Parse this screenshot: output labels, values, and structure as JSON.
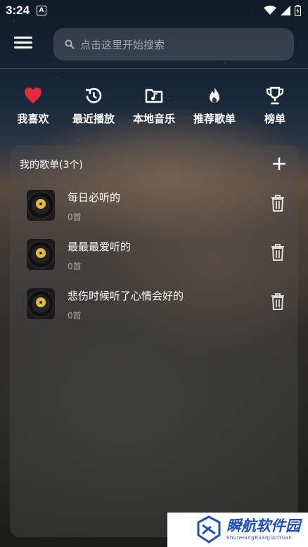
{
  "status": {
    "time": "3:24",
    "notif_letter": "A"
  },
  "search": {
    "placeholder": "点击这里开始搜索"
  },
  "quick_actions": [
    {
      "label": "我喜欢",
      "icon": "heart-icon"
    },
    {
      "label": "最近播放",
      "icon": "history-icon"
    },
    {
      "label": "本地音乐",
      "icon": "music-folder-icon"
    },
    {
      "label": "推荐歌单",
      "icon": "flame-icon"
    },
    {
      "label": "榜单",
      "icon": "trophy-icon"
    }
  ],
  "playlists": {
    "header": "我的歌单(3个)",
    "items": [
      {
        "title": "每日必听的",
        "count": "0首"
      },
      {
        "title": "最最最爱听的",
        "count": "0首"
      },
      {
        "title": "悲伤时候听了心情会好的",
        "count": "0首"
      }
    ]
  },
  "watermark": {
    "main": "瞬航软件园",
    "sub": "ShunHangRuanJianYuan"
  },
  "colors": {
    "heart": "#e8283a",
    "watermark_blue": "#1c4fc3"
  }
}
